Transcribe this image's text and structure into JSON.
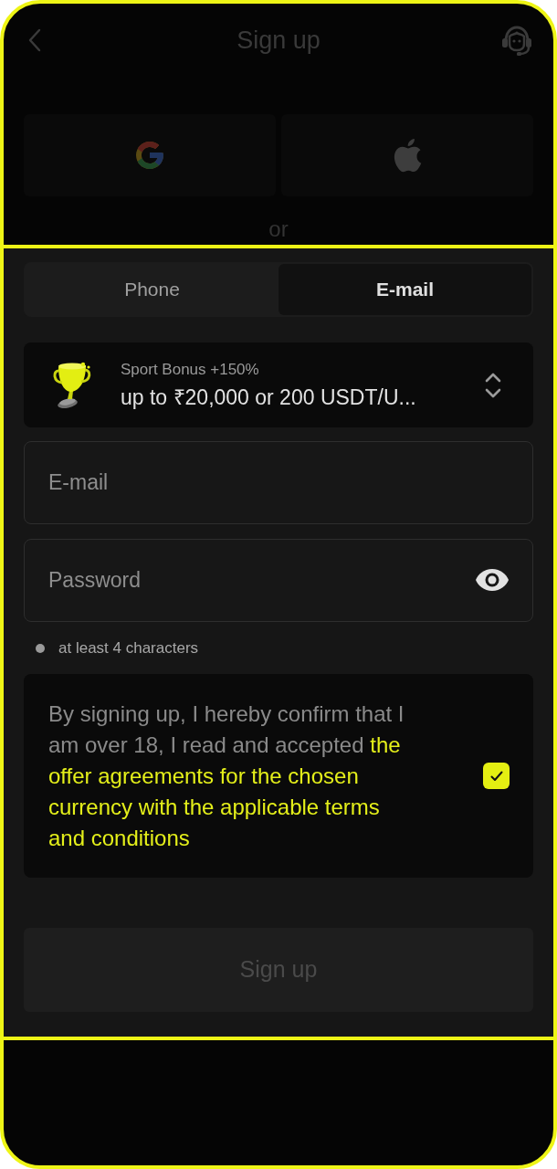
{
  "header": {
    "title": "Sign up"
  },
  "divider_text": "or",
  "tabs": [
    {
      "label": "Phone",
      "selected": false
    },
    {
      "label": "E-mail",
      "selected": true
    }
  ],
  "bonus_select": {
    "label": "Sport Bonus +150%",
    "value": "up to ₹20,000 or 200 USDT/U..."
  },
  "email_field": {
    "placeholder": "E-mail"
  },
  "password_field": {
    "placeholder": "Password"
  },
  "password_hint": "at least 4 characters",
  "terms": {
    "text": "By signing up, I hereby confirm that I am over 18, I read and accepted",
    "link": "the offer agreements for the chosen currency with the applicable terms and conditions",
    "checked": true
  },
  "submit_button": {
    "label": "Sign up",
    "disabled": true
  }
}
